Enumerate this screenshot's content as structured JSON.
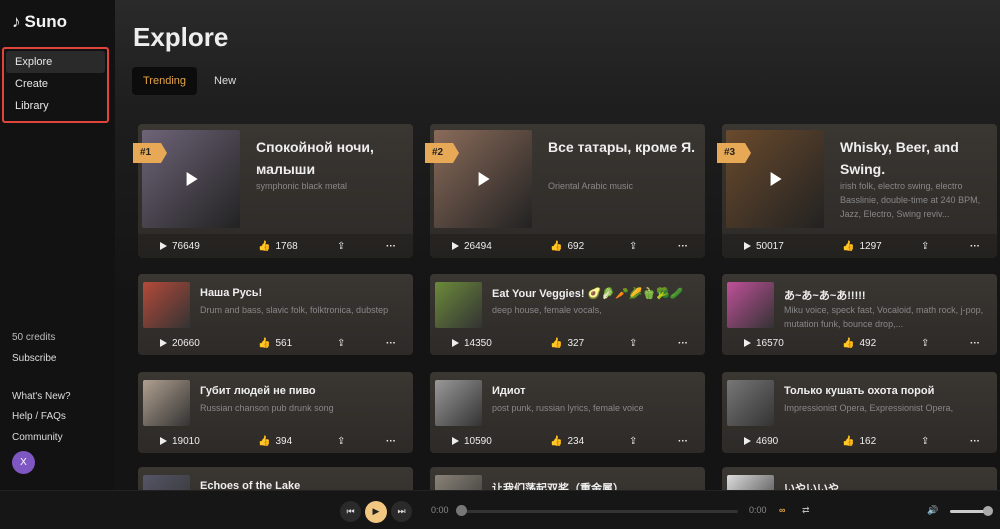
{
  "app": {
    "name": "Suno"
  },
  "sidebar": {
    "nav": [
      {
        "label": "Explore",
        "active": true
      },
      {
        "label": "Create"
      },
      {
        "label": "Library"
      }
    ],
    "credits": "50 credits",
    "subscribe": "Subscribe",
    "whats_new": "What's New?",
    "help": "Help / FAQs",
    "community": "Community",
    "avatar_initial": "X"
  },
  "main": {
    "title": "Explore",
    "tabs": [
      {
        "label": "Trending",
        "active": true
      },
      {
        "label": "New"
      }
    ]
  },
  "featured": [
    {
      "rank": "#1",
      "title": "Спокойной ночи, малыши",
      "tags": "symphonic black metal",
      "plays": "76649",
      "likes": "1768",
      "art": "#6e6478"
    },
    {
      "rank": "#2",
      "title": "Все татары, кроме Я.",
      "tags": "Oriental Arabic music",
      "plays": "26494",
      "likes": "692",
      "art": "#8a6b5a"
    },
    {
      "rank": "#3",
      "title": "Whisky, Beer, and Swing.",
      "tags": "irish folk, electro swing, electro Basslinie, double-time at 240 BPM, Jazz, Electro, Swing reviv...",
      "plays": "50017",
      "likes": "1297",
      "art": "#6a4a2c"
    }
  ],
  "songs": [
    {
      "title": "Наша Русь!",
      "tags": "Drum and bass, slavic folk, folktronica, dubstep",
      "plays": "20660",
      "likes": "561",
      "art": "#b44a3a"
    },
    {
      "title": "Eat Your Veggies! 🥑🥬🥕🌽🫑🥦🥒",
      "tags": "deep house, female vocals,",
      "plays": "14350",
      "likes": "327",
      "art": "#6c8a3a"
    },
    {
      "title": "あ~あ~あ~あ!!!!!",
      "tags": "Miku voice, speck fast, Vocaloid, math rock, j-pop, mutation funk, bounce drop,...",
      "plays": "16570",
      "likes": "492",
      "art": "#c0509a"
    },
    {
      "title": "Губит людей не пиво",
      "tags": "Russian chanson pub drunk song",
      "plays": "19010",
      "likes": "394",
      "art": "#b0a090"
    },
    {
      "title": "Идиот",
      "tags": "post punk, russian lyrics, female voice",
      "plays": "10590",
      "likes": "234",
      "art": "#999"
    },
    {
      "title": "Только кушать охота порой",
      "tags": "Impressionist Opera, Expressionist Opera,",
      "plays": "4690",
      "likes": "162",
      "art": "#777"
    },
    {
      "title": "Echoes of the Lake",
      "tags": "",
      "plays": "",
      "likes": "",
      "art": "#556"
    },
    {
      "title": "让我们荡起双桨（重金属）",
      "tags": "",
      "plays": "",
      "likes": "",
      "art": "#8a8378"
    },
    {
      "title": "いやいいや",
      "tags": "",
      "plays": "",
      "likes": "",
      "art": "#ddd"
    }
  ],
  "player": {
    "current_time": "0:00",
    "duration": "0:00",
    "progress": 0,
    "volume": 1,
    "accent": "#f2c782"
  }
}
